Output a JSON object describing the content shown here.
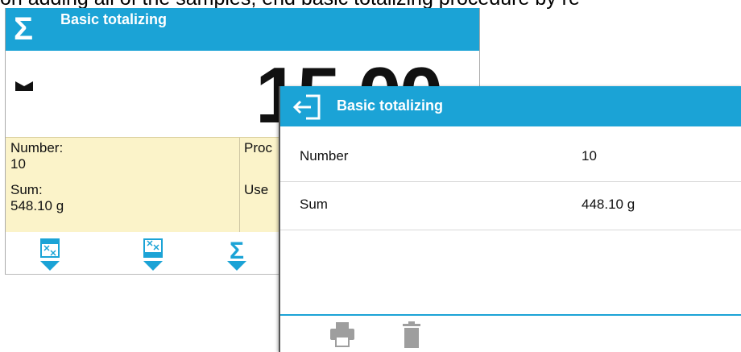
{
  "document": {
    "text_fragment": "on adding all of the samples, end basic totalizing procedure by re"
  },
  "background_screen": {
    "header": {
      "icon": "sigma-icon",
      "title": "Basic totalizing"
    },
    "unit_icon": "stable-indicator-icon",
    "reading": "15.00",
    "info": {
      "number_label": "Number:",
      "number_value": "10",
      "sum_label": "Sum:",
      "sum_value": "548.10 g",
      "product_label_partial": "Proc",
      "user_label_partial": "Use"
    },
    "toolbar": [
      {
        "icon": "add-sample-icon"
      },
      {
        "icon": "remove-sample-icon"
      },
      {
        "icon": "sigma-totals-icon"
      }
    ]
  },
  "dialog": {
    "header": {
      "icon": "back-arrow-icon",
      "title": "Basic totalizing"
    },
    "rows": [
      {
        "label": "Number",
        "value": "10"
      },
      {
        "label": "Sum",
        "value": "448.10 g"
      }
    ],
    "footer": [
      {
        "icon": "printer-icon"
      },
      {
        "icon": "trash-icon"
      }
    ],
    "colors": {
      "accent": "#1ba3d6",
      "icon_gray": "#9e9e9e"
    }
  }
}
